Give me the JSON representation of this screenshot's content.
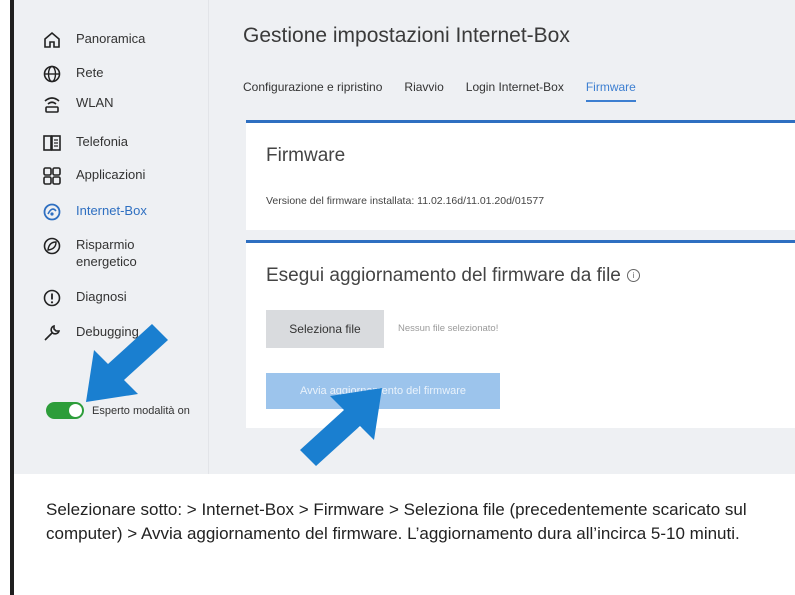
{
  "sidebar": {
    "items": [
      {
        "label": "Panoramica",
        "icon": "home-icon"
      },
      {
        "label": "Rete",
        "icon": "globe-icon"
      },
      {
        "label": "WLAN",
        "icon": "wifi-icon"
      },
      {
        "label": "Telefonia",
        "icon": "phone-icon"
      },
      {
        "label": "Applicazioni",
        "icon": "apps-icon"
      },
      {
        "label": "Internet-Box",
        "icon": "box-icon",
        "active": true
      },
      {
        "label": "Risparmio energetico",
        "icon": "energy-icon"
      },
      {
        "label": "Diagnosi",
        "icon": "alert-icon"
      },
      {
        "label": "Debugging",
        "icon": "wrench-icon"
      }
    ],
    "expert_mode_label": "Esperto modalità on",
    "expert_mode_on": true
  },
  "main": {
    "title": "Gestione impostazioni Internet-Box",
    "tabs": [
      {
        "label": "Configurazione e ripristino"
      },
      {
        "label": "Riavvio"
      },
      {
        "label": "Login Internet-Box"
      },
      {
        "label": "Firmware",
        "active": true
      }
    ],
    "firmware_card": {
      "title": "Firmware",
      "version_text": "Versione del firmware installata: 11.02.16d/11.01.20d/01577"
    },
    "update_card": {
      "title": "Esegui aggiornamento del firmware da file",
      "select_button": "Seleziona file",
      "no_file_text": "Nessun file selezionato!",
      "update_button": "Avvia aggiornamento del firmware"
    }
  },
  "caption": "Selezionare sotto: > Internet-Box > Firmware > Seleziona file (precedentemente scaricato sul computer) > Avvia aggiornamento del firmware. L’aggiornamento dura all’incirca 5-10 minuti.",
  "colors": {
    "accent": "#2e6fc1",
    "arrow": "#1a7fd0",
    "toggle_on": "#2d9d3a",
    "update_button_disabled": "#9cc4ec"
  }
}
